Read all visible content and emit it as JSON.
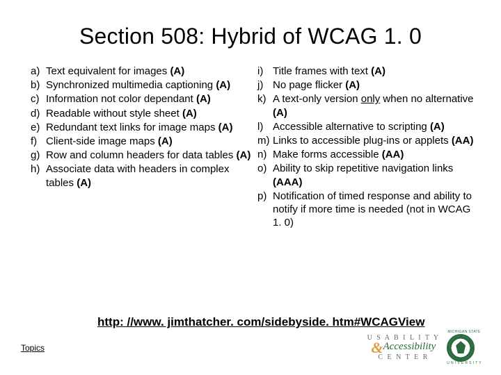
{
  "title": "Section 508: Hybrid of WCAG 1. 0",
  "left": [
    {
      "m": "a)",
      "t": "Text equivalent for images",
      "p": "(A)"
    },
    {
      "m": "b)",
      "t": "Synchronized multimedia captioning",
      "p": "(A)"
    },
    {
      "m": "c)",
      "t": "Information not color dependant",
      "p": "(A)"
    },
    {
      "m": "d)",
      "t": "Readable without style sheet",
      "p": "(A)"
    },
    {
      "m": "e)",
      "t": "Redundant text links for image maps",
      "p": "(A)"
    },
    {
      "m": "f)",
      "t": "Client-side image maps",
      "p": "(A)"
    },
    {
      "m": "g)",
      "t": "Row and column headers for data tables",
      "p": "(A)"
    },
    {
      "m": "h)",
      "t": "Associate data with headers in complex tables",
      "p": "(A)"
    }
  ],
  "right": [
    {
      "m": "i)",
      "t": "Title frames with text",
      "p": "(A)"
    },
    {
      "m": "j)",
      "t": "No page flicker",
      "p": "(A)"
    },
    {
      "m": "k)",
      "t1": "A text-only version ",
      "u": "only",
      "t2": " when no alternative",
      "p": "(A)"
    },
    {
      "m": "l)",
      "t": "Accessible alternative to scripting",
      "p": "(A)"
    },
    {
      "m": "m)",
      "t": "Links to accessible plug-ins or applets",
      "p": "(AA)"
    },
    {
      "m": "n)",
      "t": "Make forms accessible",
      "p": "(AA)"
    },
    {
      "m": "o)",
      "t": "Ability to skip repetitive navigation links",
      "p": "(AAA)"
    },
    {
      "m": "p)",
      "t": "Notification of timed response and ability to notify if more time is needed (not in WCAG 1. 0)",
      "p": ""
    }
  ],
  "link": "http: //www. jimthatcher. com/sidebyside. htm#WCAGView",
  "topics": "Topics",
  "logo": {
    "row1": "U S A B I L I T Y",
    "acc": "Accessibility",
    "cent": "C E N T E R",
    "msu1": "MICHIGAN STATE",
    "msu2": "U N I V E R S I T Y"
  }
}
